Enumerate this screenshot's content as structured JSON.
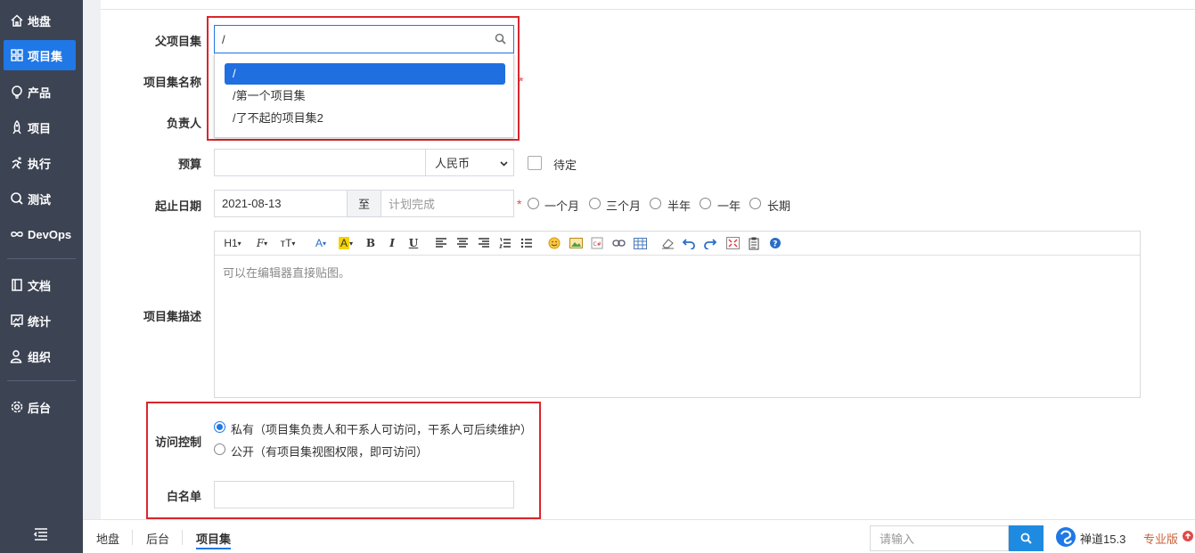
{
  "sidebar": {
    "items": [
      {
        "label": "地盘",
        "icon": "home-icon"
      },
      {
        "label": "项目集",
        "icon": "grid-icon"
      },
      {
        "label": "产品",
        "icon": "lightbulb-icon"
      },
      {
        "label": "项目",
        "icon": "rocket-icon"
      },
      {
        "label": "执行",
        "icon": "run-icon"
      },
      {
        "label": "测试",
        "icon": "search-icon"
      },
      {
        "label": "DevOps",
        "icon": "infinity-icon"
      },
      {
        "label": "文档",
        "icon": "book-icon"
      },
      {
        "label": "统计",
        "icon": "chart-icon"
      },
      {
        "label": "组织",
        "icon": "users-icon"
      },
      {
        "label": "后台",
        "icon": "gear-icon"
      }
    ],
    "active": "项目集"
  },
  "form": {
    "parent_label": "父项目集",
    "parent_value": "/",
    "parent_options": [
      "/",
      "/第一个项目集",
      "/了不起的项目集2"
    ],
    "name_label": "项目集名称",
    "owner_label": "负责人",
    "budget_label": "预算",
    "budget_value": "",
    "currency": "人民币",
    "budget_pending": "待定",
    "date_label": "起止日期",
    "start_date": "2021-08-13",
    "date_sep": "至",
    "end_placeholder": "计划完成",
    "durations": [
      "一个月",
      "三个月",
      "半年",
      "一年",
      "长期"
    ],
    "desc_label": "项目集描述",
    "desc_placeholder": "可以在编辑器直接贴图。",
    "acl_label": "访问控制",
    "acl_private": "私有（项目集负责人和干系人可访问，干系人可后续维护）",
    "acl_public": "公开（有项目集视图权限，即可访问）",
    "whitelist_label": "白名单",
    "required_mark": "*"
  },
  "toolbar": {
    "h1": "H1",
    "font": "F",
    "size": "тT",
    "color": "A",
    "bg": "A",
    "bold": "B",
    "italic": "I",
    "underline": "U"
  },
  "bottom": {
    "crumbs": [
      "地盘",
      "后台",
      "项目集"
    ],
    "search_placeholder": "请输入",
    "version": "禅道15.3",
    "edition": "专业版"
  },
  "colors": {
    "accent": "#1f78e6",
    "sidebar_bg": "#3c4353",
    "highlight_box": "#d9262c"
  }
}
